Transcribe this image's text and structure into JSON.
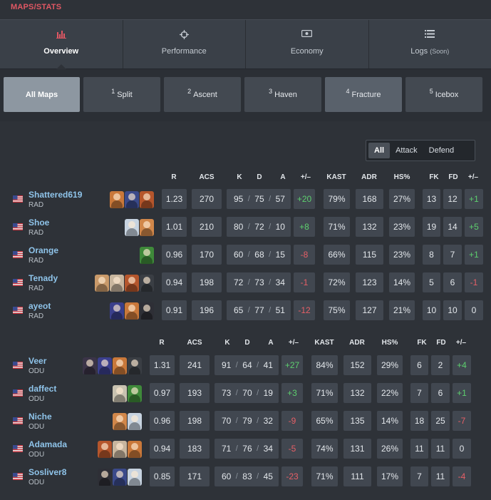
{
  "breadcrumb": "MAPS/STATS",
  "nav": [
    {
      "label": "Overview",
      "icon": "bar-chart-icon",
      "active": true,
      "soon": ""
    },
    {
      "label": "Performance",
      "icon": "crosshair-icon",
      "active": false,
      "soon": ""
    },
    {
      "label": "Economy",
      "icon": "money-icon",
      "active": false,
      "soon": ""
    },
    {
      "label": "Logs",
      "icon": "list-icon",
      "active": false,
      "soon": "(Soon)"
    }
  ],
  "maps": [
    {
      "num": "",
      "name": "All Maps"
    },
    {
      "num": "1",
      "name": "Split"
    },
    {
      "num": "2",
      "name": "Ascent"
    },
    {
      "num": "3",
      "name": "Haven"
    },
    {
      "num": "4",
      "name": "Fracture"
    },
    {
      "num": "5",
      "name": "Icebox"
    }
  ],
  "side_toggle": [
    "All",
    "Attack",
    "Defend"
  ],
  "columns": [
    "R",
    "ACS",
    "K",
    "D",
    "A",
    "+/–",
    "KAST",
    "ADR",
    "HS%",
    "FK",
    "FD",
    "+/–"
  ],
  "colors": {
    "positive": "#5dcf6e",
    "negative": "#e65f66",
    "player_name": "#8fc4ea",
    "breadcrumb": "#e05763"
  },
  "teams": [
    {
      "players": [
        {
          "name": "Shattered619",
          "team": "RAD",
          "agents": [
            "#c9783a",
            "#3b4a8a",
            "#b5562c"
          ],
          "r": "1.23",
          "acs": "270",
          "k": "95",
          "d": "75",
          "a": "57",
          "pm": "+20",
          "kast": "79%",
          "adr": "168",
          "hs": "27%",
          "fk": "13",
          "fd": "12",
          "fpm": "+1"
        },
        {
          "name": "Shoe",
          "team": "RAD",
          "agents": [
            "#c7d3e0",
            "#d1874a"
          ],
          "r": "1.01",
          "acs": "210",
          "k": "80",
          "d": "72",
          "a": "10",
          "pm": "+8",
          "kast": "71%",
          "adr": "132",
          "hs": "23%",
          "fk": "19",
          "fd": "14",
          "fpm": "+5"
        },
        {
          "name": "Orange",
          "team": "RAD",
          "agents": [
            "#3f8a3a"
          ],
          "r": "0.96",
          "acs": "170",
          "k": "60",
          "d": "68",
          "a": "15",
          "pm": "-8",
          "kast": "66%",
          "adr": "115",
          "hs": "23%",
          "fk": "8",
          "fd": "7",
          "fpm": "+1"
        },
        {
          "name": "Tenady",
          "team": "RAD",
          "agents": [
            "#c99a6a",
            "#c8b69e",
            "#b5562c",
            "#3a3e44"
          ],
          "r": "0.94",
          "acs": "198",
          "k": "72",
          "d": "73",
          "a": "34",
          "pm": "-1",
          "kast": "72%",
          "adr": "123",
          "hs": "14%",
          "fk": "5",
          "fd": "6",
          "fpm": "-1"
        },
        {
          "name": "ayeot",
          "team": "RAD",
          "agents": [
            "#3a3f8c",
            "#c9783a",
            "#2e2f36"
          ],
          "r": "0.91",
          "acs": "196",
          "k": "65",
          "d": "77",
          "a": "51",
          "pm": "-12",
          "kast": "75%",
          "adr": "127",
          "hs": "21%",
          "fk": "10",
          "fd": "10",
          "fpm": "0"
        }
      ]
    },
    {
      "players": [
        {
          "name": "Veer",
          "team": "ODU",
          "agents": [
            "#3b3448",
            "#3b3f8e",
            "#c9783a",
            "#3a3e44"
          ],
          "r": "1.31",
          "acs": "241",
          "k": "91",
          "d": "64",
          "a": "41",
          "pm": "+27",
          "kast": "84%",
          "adr": "152",
          "hs": "29%",
          "fk": "6",
          "fd": "2",
          "fpm": "+4"
        },
        {
          "name": "daffect",
          "team": "ODU",
          "agents": [
            "#c8c2b0",
            "#3f8a3a"
          ],
          "r": "0.97",
          "acs": "193",
          "k": "73",
          "d": "70",
          "a": "19",
          "pm": "+3",
          "kast": "71%",
          "adr": "132",
          "hs": "22%",
          "fk": "7",
          "fd": "6",
          "fpm": "+1"
        },
        {
          "name": "Niche",
          "team": "ODU",
          "agents": [
            "#d1874a",
            "#c7d3e0"
          ],
          "r": "0.96",
          "acs": "198",
          "k": "70",
          "d": "79",
          "a": "32",
          "pm": "-9",
          "kast": "65%",
          "adr": "135",
          "hs": "14%",
          "fk": "18",
          "fd": "25",
          "fpm": "-7"
        },
        {
          "name": "Adamada",
          "team": "ODU",
          "agents": [
            "#b5562c",
            "#c8b69e",
            "#c9783a"
          ],
          "r": "0.94",
          "acs": "183",
          "k": "71",
          "d": "76",
          "a": "34",
          "pm": "-5",
          "kast": "74%",
          "adr": "131",
          "hs": "26%",
          "fk": "11",
          "fd": "11",
          "fpm": "0"
        },
        {
          "name": "Sosliver8",
          "team": "ODU",
          "agents": [
            "#2e2f36",
            "#3b4a8a",
            "#c7d3e0"
          ],
          "r": "0.85",
          "acs": "171",
          "k": "60",
          "d": "83",
          "a": "45",
          "pm": "-23",
          "kast": "71%",
          "adr": "111",
          "hs": "17%",
          "fk": "7",
          "fd": "11",
          "fpm": "-4"
        }
      ]
    }
  ]
}
